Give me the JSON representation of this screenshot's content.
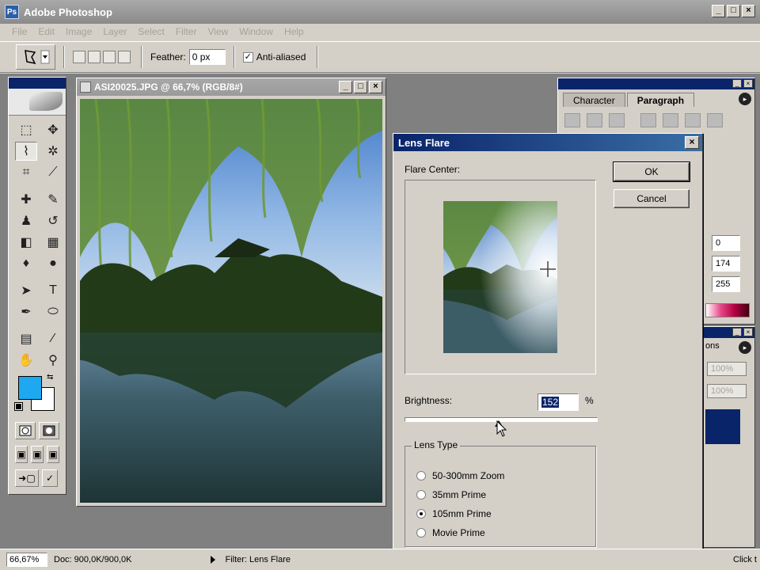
{
  "app": {
    "title": "Adobe Photoshop",
    "icon": "Ps"
  },
  "menubar": {
    "items": [
      "File",
      "Edit",
      "Image",
      "Layer",
      "Select",
      "Filter",
      "View",
      "Window",
      "Help"
    ]
  },
  "options": {
    "feather_label": "Feather:",
    "feather_value": "0 px",
    "antialiased_label": "Anti-aliased",
    "antialiased_checked": true
  },
  "document": {
    "title": "ASI20025.JPG @ 66,7% (RGB/8#)"
  },
  "colors": {
    "foreground": "#1ea8f0",
    "background": "#ffffff"
  },
  "palette1": {
    "tabs": [
      "Character",
      "Paragraph"
    ],
    "active_tab": "Paragraph",
    "fields": [
      "0",
      "174",
      "255"
    ]
  },
  "palette2": {
    "tab": "ons",
    "fields": [
      "100%",
      "100%"
    ]
  },
  "dialog": {
    "title": "Lens Flare",
    "flare_center_label": "Flare Center:",
    "ok_label": "OK",
    "cancel_label": "Cancel",
    "brightness_label": "Brightness:",
    "brightness_value": "152",
    "brightness_unit": "%",
    "lens_type_label": "Lens Type",
    "lens_options": [
      "50-300mm Zoom",
      "35mm Prime",
      "105mm Prime",
      "Movie Prime"
    ],
    "selected_lens": "105mm Prime"
  },
  "status": {
    "zoom": "66,67%",
    "doc": "Doc: 900,0K/900,0K",
    "filter": "Filter: Lens Flare",
    "click": "Click t"
  }
}
